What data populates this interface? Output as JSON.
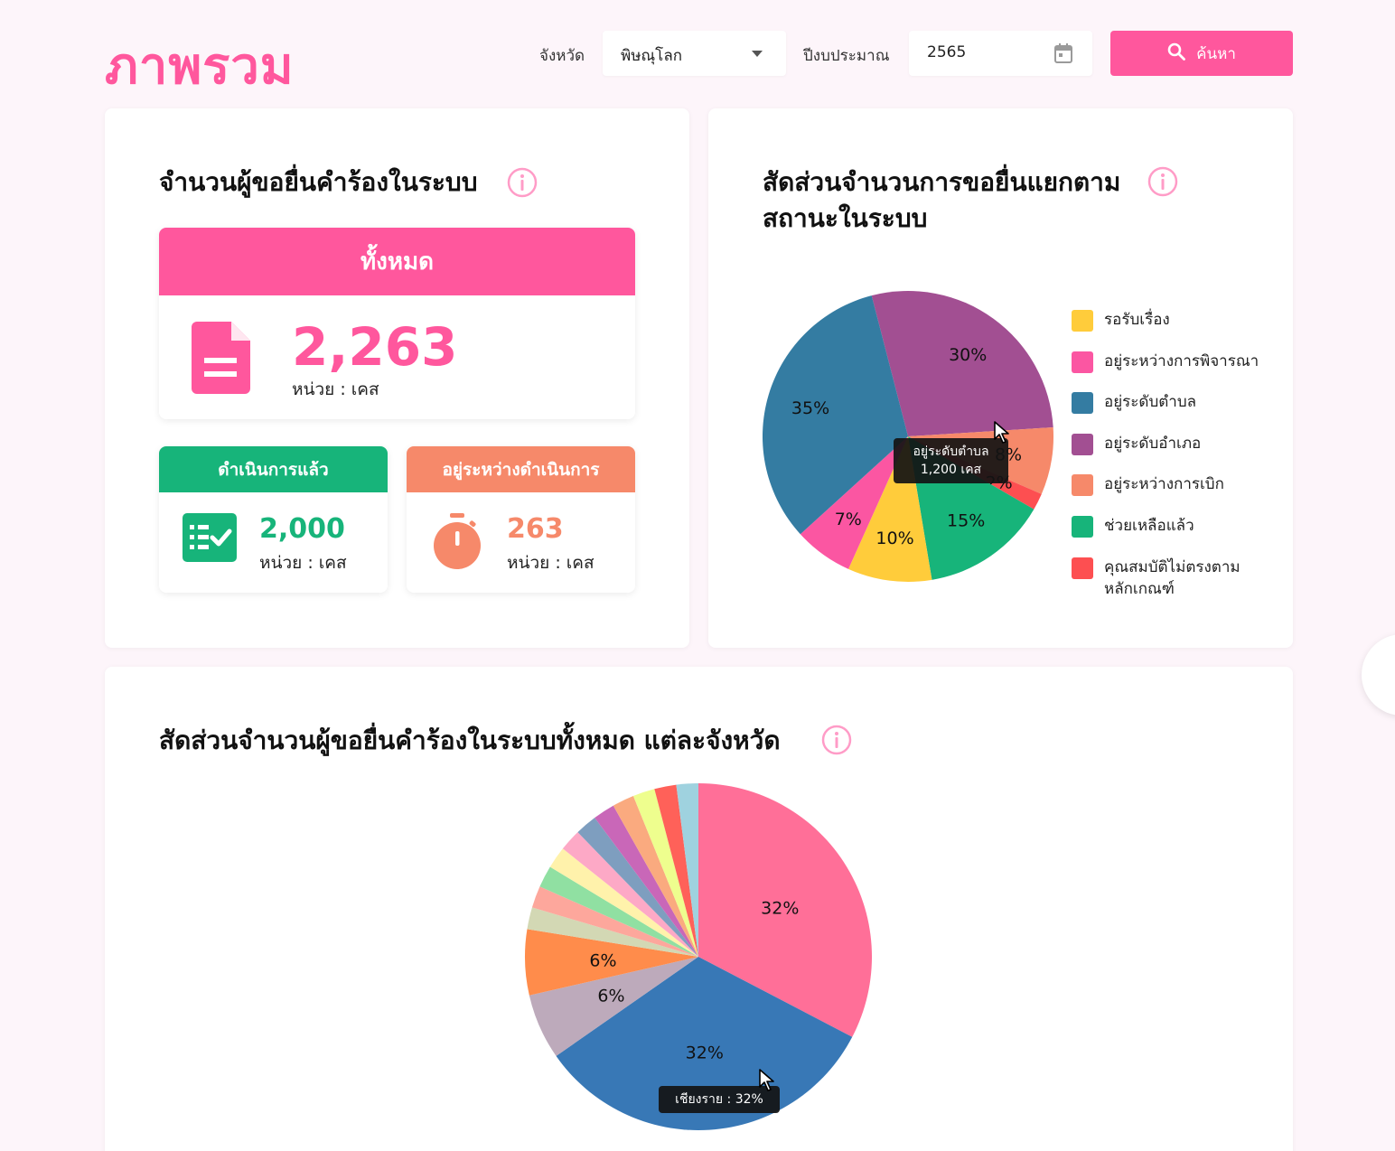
{
  "header": {
    "title": "ภาพรวม",
    "province_label": "จังหวัด",
    "province_value": "พิษณุโลก",
    "year_label": "ปีงบประมาณ",
    "year_value": "2565",
    "search_label": "ค้นหา"
  },
  "summary_card": {
    "title": "จำนวนผู้ขอยื่นคำร้องในระบบ",
    "total": {
      "label": "ทั้งหมด",
      "value": "2,263",
      "unit": "หน่วย : เคส"
    },
    "done": {
      "label": "ดำเนินการแล้ว",
      "value": "2,000",
      "unit": "หน่วย : เคส"
    },
    "pending": {
      "label": "อยู่ระหว่างดำเนินการ",
      "value": "263",
      "unit": "หน่วย : เคส"
    }
  },
  "colors": {
    "brand_pink": "#ff579d",
    "done_green": "#17b47a",
    "pending_orange": "#f6896a"
  },
  "icons": [
    "document-icon",
    "checklist-icon",
    "stopwatch-icon",
    "info-icon",
    "search-icon",
    "calendar-icon",
    "chevron-down-icon"
  ],
  "status_card": {
    "title_line1": "สัดส่วนจำนวนการขอยื่นแยกตาม",
    "title_line2": "สถานะในระบบ",
    "tooltip_line1": "อยู่ระดับตำบล",
    "tooltip_line2": "1,200 เคส"
  },
  "province_card": {
    "title": "สัดส่วนจำนวนผู้ขอยื่นคำร้องในระบบทั้งหมด แต่ละจังหวัด",
    "tooltip": "เชียงราย : 32%"
  },
  "chart_data": [
    {
      "type": "pie",
      "title": "สัดส่วนจำนวนการขอยื่นแยกตามสถานะในระบบ",
      "legend_position": "right",
      "slices": [
        {
          "label": "อยู่ระดับอำเภอ",
          "value": 30,
          "color": "#a24f92"
        },
        {
          "label": "อยู่ระหว่างการเบิก",
          "value": 8,
          "color": "#f6896a"
        },
        {
          "label": "คุณสมบัติไม่ตรงตามหลักเกณฑ์",
          "value": 2,
          "color": "#fd4f51"
        },
        {
          "label": "ช่วยเหลือแล้ว",
          "value": 15,
          "color": "#17b47a"
        },
        {
          "label": "รอรับเรื่อง",
          "value": 10,
          "color": "#ffcc3b"
        },
        {
          "label": "อยู่ระหว่างการพิจารณา",
          "value": 7,
          "color": "#fb56a2"
        },
        {
          "label": "อยู่ระดับตำบล",
          "value": 35,
          "color": "#347ca2"
        }
      ],
      "legend_order": [
        {
          "label": "รอรับเรื่อง",
          "color": "#ffcc3b"
        },
        {
          "label": "อยู่ระหว่างการพิจารณา",
          "color": "#fb56a2"
        },
        {
          "label": "อยู่ระดับตำบล",
          "color": "#347ca2"
        },
        {
          "label": "อยู่ระดับอำเภอ",
          "color": "#a24f92"
        },
        {
          "label": "อยู่ระหว่างการเบิก",
          "color": "#f6896a"
        },
        {
          "label": "ช่วยเหลือแล้ว",
          "color": "#17b47a"
        },
        {
          "label": "คุณสมบัติไม่ตรงตาม\nหลักเกณฑ์",
          "color": "#fd4f51"
        }
      ]
    },
    {
      "type": "pie",
      "title": "สัดส่วนจำนวนผู้ขอยื่นคำร้องในระบบทั้งหมด แต่ละจังหวัด",
      "slices": [
        {
          "label": "",
          "value": 32,
          "display": "32%",
          "color": "#ff6f98"
        },
        {
          "label": "เชียงราย",
          "value": 32,
          "display": "32%",
          "color": "#3878b6"
        },
        {
          "label": "",
          "value": 6,
          "display": "6%",
          "color": "#bdaabb"
        },
        {
          "label": "",
          "value": 6,
          "display": "6%",
          "color": "#ff8c4b"
        },
        {
          "label": "",
          "value": 2,
          "display": "",
          "color": "#d3d8b4"
        },
        {
          "label": "",
          "value": 2,
          "display": "",
          "color": "#fda79c"
        },
        {
          "label": "",
          "value": 2,
          "display": "",
          "color": "#90e0a2"
        },
        {
          "label": "",
          "value": 2,
          "display": "",
          "color": "#fff2ab"
        },
        {
          "label": "",
          "value": 2,
          "display": "",
          "color": "#fda9c6"
        },
        {
          "label": "",
          "value": 2,
          "display": "",
          "color": "#7e9ebf"
        },
        {
          "label": "",
          "value": 2,
          "display": "",
          "color": "#c967b8"
        },
        {
          "label": "",
          "value": 2,
          "display": "",
          "color": "#faaa7f"
        },
        {
          "label": "",
          "value": 2,
          "display": "",
          "color": "#eefe8e"
        },
        {
          "label": "",
          "value": 2,
          "display": "",
          "color": "#ff6159"
        },
        {
          "label": "",
          "value": 2,
          "display": "",
          "color": "#9fd2df"
        }
      ]
    }
  ]
}
